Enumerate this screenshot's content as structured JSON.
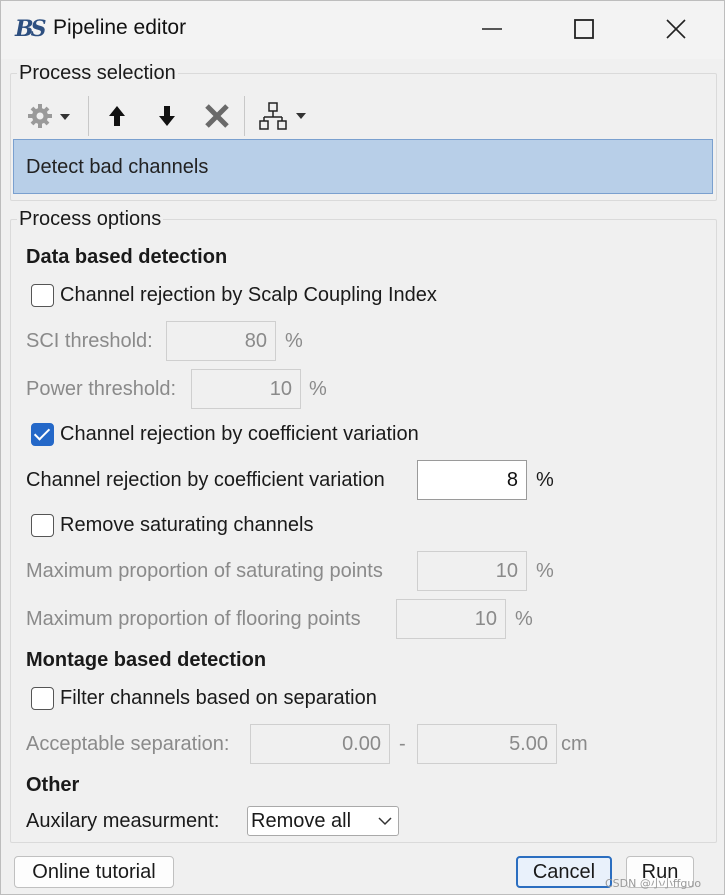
{
  "window": {
    "title": "Pipeline editor",
    "logo_text": "BS"
  },
  "process_selection": {
    "label": "Process selection",
    "toolbar": [
      "gear-icon",
      "arrow-up-icon",
      "arrow-down-icon",
      "delete-icon",
      "pipeline-tree-icon"
    ],
    "selected_process": "Detect bad channels"
  },
  "process_options": {
    "label": "Process options",
    "data_based": {
      "heading": "Data based detection",
      "sci_checkbox": {
        "label": "Channel rejection by Scalp Coupling Index",
        "checked": false
      },
      "sci_threshold": {
        "label": "SCI threshold:",
        "value": "80",
        "unit": "%"
      },
      "power_threshold": {
        "label": "Power threshold:",
        "value": "10",
        "unit": "%"
      },
      "cv_checkbox": {
        "label": "Channel rejection by coefficient variation",
        "checked": true
      },
      "cv_value": {
        "label": "Channel rejection by coefficient variation",
        "value": "8",
        "unit": "%"
      },
      "saturating_checkbox": {
        "label": "Remove saturating channels",
        "checked": false
      },
      "max_saturating": {
        "label": "Maximum proportion of saturating points",
        "value": "10",
        "unit": "%"
      },
      "max_flooring": {
        "label": "Maximum proportion of flooring points",
        "value": "10",
        "unit": "%"
      }
    },
    "montage_based": {
      "heading": "Montage based detection",
      "separation_checkbox": {
        "label": "Filter channels based on separation",
        "checked": false
      },
      "acceptable_separation": {
        "label": "Acceptable separation:",
        "min": "0.00",
        "dash": "-",
        "max": "5.00",
        "unit": "cm"
      }
    },
    "other": {
      "heading": "Other",
      "auxiliary": {
        "label": "Auxilary measurment:",
        "selected": "Remove all"
      }
    }
  },
  "footer": {
    "online_tutorial": "Online tutorial",
    "cancel": "Cancel",
    "run": "Run",
    "watermark": "CSDN @小小ffguo"
  },
  "colors": {
    "selection_bg": "#b8cfe8",
    "checkbox_checked": "#2468c8",
    "default_button_border": "#2b6ec0"
  }
}
